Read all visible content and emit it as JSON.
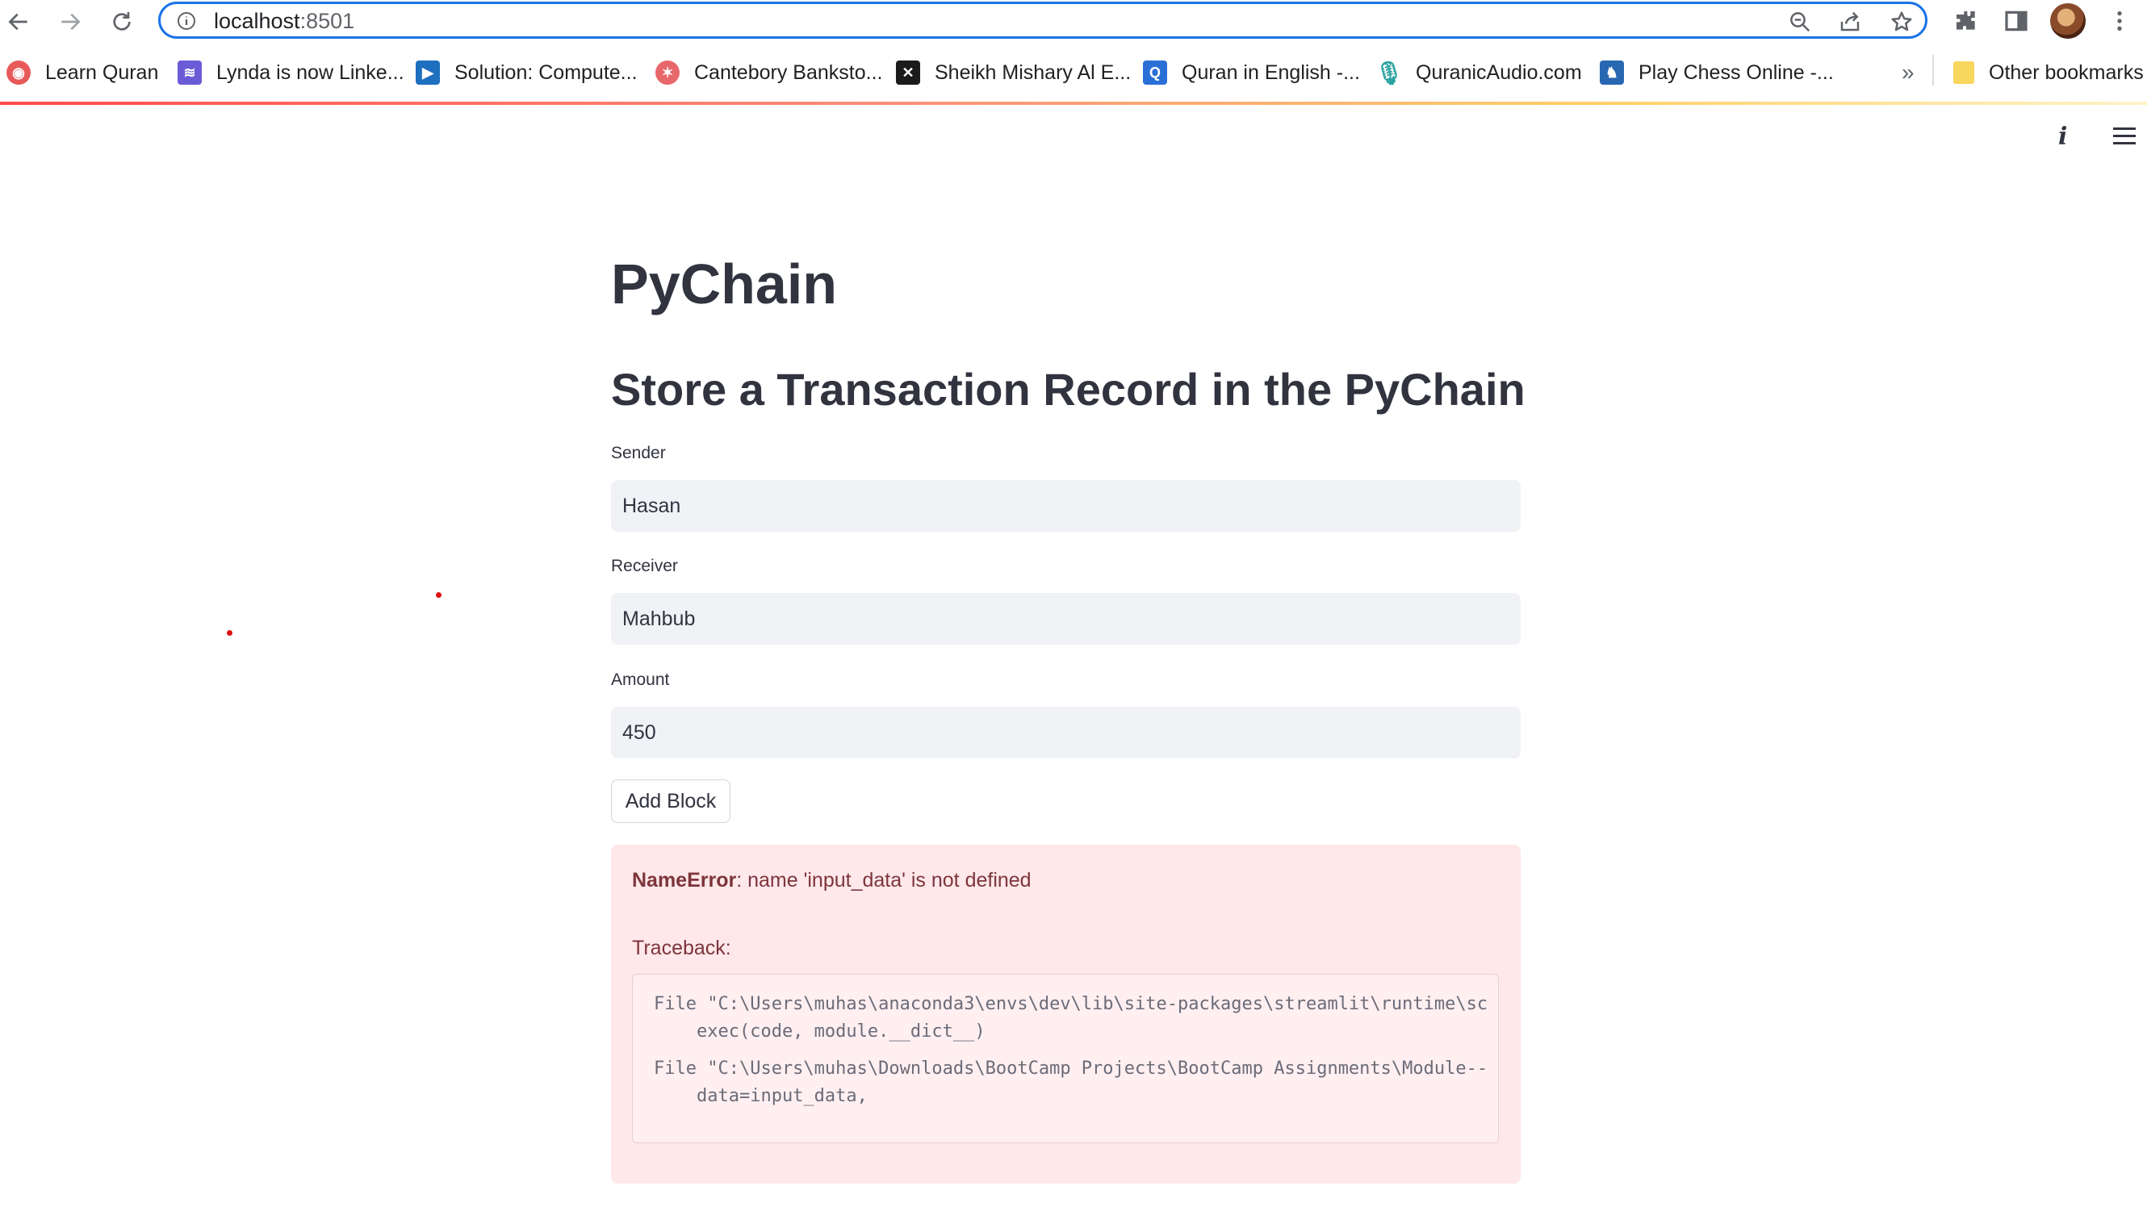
{
  "browser": {
    "url_host": "localhost",
    "url_port": ":8501",
    "bookmarks": [
      {
        "label": "Learn Quran",
        "color": "#e85a5a"
      },
      {
        "label": "Lynda is now Linke...",
        "color": "#6b5bd6"
      },
      {
        "label": "Solution: Compute...",
        "color": "#1e6fbf"
      },
      {
        "label": "Cantebory Banksto...",
        "color": "#e8676b"
      },
      {
        "label": "Sheikh Mishary Al E...",
        "color": "#1b1b1b"
      },
      {
        "label": "Quran in English -...",
        "color": "#2a6fd6"
      },
      {
        "label": "QuranicAudio.com",
        "color": "#2aa3a0"
      },
      {
        "label": "Play Chess Online -...",
        "color": "#2867b2"
      }
    ],
    "overflow_label": "»",
    "other_bookmarks": "Other bookmarks"
  },
  "page": {
    "title": "PyChain",
    "subtitle": "Store a Transaction Record in the PyChain"
  },
  "form": {
    "sender_label": "Sender",
    "sender_value": "Hasan",
    "receiver_label": "Receiver",
    "receiver_value": "Mahbub",
    "amount_label": "Amount",
    "amount_value": "450",
    "add_block_label": "Add Block"
  },
  "error": {
    "type": "NameError",
    "message": ": name 'input_data' is not defined",
    "traceback_label": "Traceback:",
    "lines": [
      "File \"C:\\Users\\muhas\\anaconda3\\envs\\dev\\lib\\site-packages\\streamlit\\runtime\\sc",
      "    exec(code, module.__dict__)",
      "File \"C:\\Users\\muhas\\Downloads\\BootCamp Projects\\BootCamp Assignments\\Module--",
      "    data=input_data,"
    ]
  },
  "colors": {
    "accent": "#1a73e8",
    "error_bg": "#ffe8ea",
    "error_text": "#7d353b",
    "input_bg": "#f0f2f6"
  }
}
